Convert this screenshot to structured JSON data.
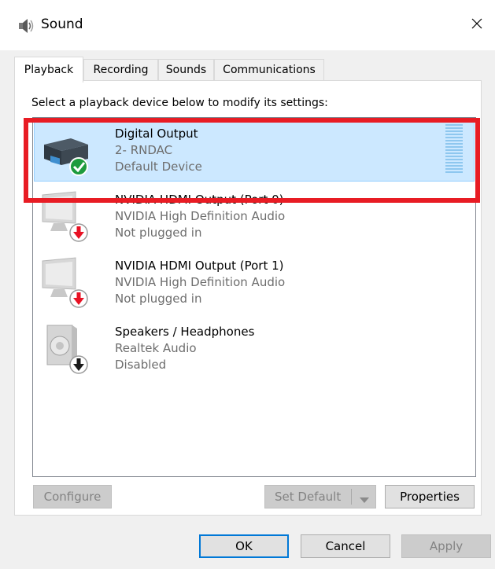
{
  "window": {
    "title": "Sound",
    "icon": "speaker-icon",
    "close_icon": "close-icon"
  },
  "tabs": [
    {
      "label": "Playback",
      "active": true
    },
    {
      "label": "Recording",
      "active": false
    },
    {
      "label": "Sounds",
      "active": false
    },
    {
      "label": "Communications",
      "active": false
    }
  ],
  "playback": {
    "instruction": "Select a playback device below to modify its settings:",
    "devices": [
      {
        "name": "Digital Output",
        "driver": "2- RNDAC",
        "status": "Default Device",
        "icon": "digital-output-icon",
        "badge": "default-check-icon",
        "selected": true
      },
      {
        "name": "NVIDIA HDMI Output (Port 0)",
        "driver": "NVIDIA High Definition Audio",
        "status": "Not plugged in",
        "icon": "monitor-icon",
        "badge": "unplugged-arrow-icon",
        "selected": false
      },
      {
        "name": "NVIDIA HDMI Output (Port 1)",
        "driver": "NVIDIA High Definition Audio",
        "status": "Not plugged in",
        "icon": "monitor-icon",
        "badge": "unplugged-arrow-icon",
        "selected": false
      },
      {
        "name": "Speakers / Headphones",
        "driver": "Realtek Audio",
        "status": "Disabled",
        "icon": "speaker-icon",
        "badge": "disabled-arrow-icon",
        "selected": false
      }
    ]
  },
  "buttons": {
    "configure": "Configure",
    "set_default": "Set Default",
    "properties": "Properties",
    "ok": "OK",
    "cancel": "Cancel",
    "apply": "Apply"
  },
  "colors": {
    "selection_bg": "#cce8ff",
    "highlight_box": "#e81c24",
    "check_badge": "#1e9b3d",
    "unplugged_badge": "#e81123",
    "default_button_border": "#0078d7"
  }
}
